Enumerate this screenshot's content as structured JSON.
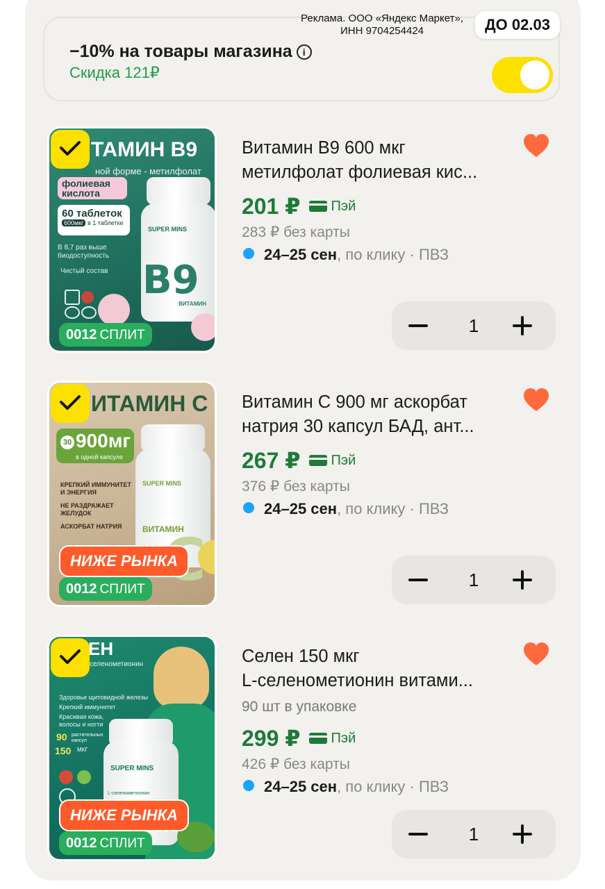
{
  "ad": {
    "line1": "Реклама. ООО «Яндекс Маркет»,",
    "line2": "ИНН 9704254424",
    "date_badge": "ДО 02.03"
  },
  "promo": {
    "title": "−10% на товары магазина",
    "info_icon": "i",
    "discount": "Скидка 121₽",
    "toggle_on": true,
    "toggle_color": "#fce000"
  },
  "items": [
    {
      "name_line1": "Витамин B9 600 мкг",
      "name_line2": "метилфолат фолиевая кис...",
      "pack": "",
      "price": "201 ₽",
      "pay": "Пэй",
      "old_price": "283 ₽  без карты",
      "delivery_date": "24–25 сен",
      "delivery_rest": ", по клику · ПВЗ",
      "qty": "1",
      "minus": "−",
      "plus": "+",
      "thumb": {
        "title": "ТАМИН B9",
        "subtitle": "ной форме - метилфолат",
        "tag": "фолиевая кислота",
        "tablets": "60 таблеток",
        "dose": "600мкг",
        "dose_note": "в 1 таблетке",
        "bio": "В 8,7 раз выше биодоступность",
        "clean": "Чистый состав",
        "brand": "SUPER MINS",
        "letter": "B9",
        "label_small": "ВИТАМИН",
        "split": "0012",
        "split_word": "СПЛИТ",
        "lower": ""
      }
    },
    {
      "name_line1": "Витамин C 900 мг аскорбат",
      "name_line2": "натрия 30 капсул БАД, ант...",
      "pack": "",
      "price": "267 ₽",
      "pay": "Пэй",
      "old_price": "376 ₽  без карты",
      "delivery_date": "24–25 сен",
      "delivery_rest": ", по клику · ПВЗ",
      "qty": "1",
      "minus": "−",
      "plus": "+",
      "thumb": {
        "title": "ИТАМИН С",
        "dose": "900мг",
        "count": "30",
        "dose_note": "в одной капсуле",
        "b1": "КРЕПКИЙ ИММУНИТЕТ И ЭНЕРГИЯ",
        "b2": "НЕ РАЗДРАЖАЕТ ЖЕЛУДОК",
        "b3": "АСКОРБАТ НАТРИЯ",
        "brand": "SUPER MINS",
        "label_small": "ВИТАМИН",
        "letter": "C",
        "split": "0012",
        "split_word": "СПЛИТ",
        "lower": "НИЖЕ РЫНКА"
      }
    },
    {
      "name_line1": "Селен 150 мкг",
      "name_line2": "L-селенометионин витами...",
      "pack": "90 шт в упаковке",
      "price": "299 ₽",
      "pay": "Пэй",
      "old_price": "426 ₽  без карты",
      "delivery_date": "24–25 сен",
      "delivery_rest": ", по клику · ПВЗ",
      "qty": "1",
      "minus": "−",
      "plus": "+",
      "thumb": {
        "title": "ЕН",
        "sub": "селенометионин",
        "b1": "Здоровье щитовидной железы",
        "b2": "Крепкий иммунитет",
        "b3": "Красивая кожа, волосы и ногти",
        "caps": "90",
        "caps_note": "растительных капсул",
        "mcg": "150",
        "mcg_note": "МКГ",
        "brand": "SUPER MINS",
        "label_small": "L-селенометионин",
        "split": "0012",
        "split_word": "СПЛИТ",
        "lower": "НИЖЕ РЫНКА"
      }
    }
  ],
  "colors": {
    "accent_yellow": "#fce000",
    "price_green": "#1f7a3a",
    "discount_green": "#1f9d48",
    "heart": "#ff6a3d",
    "delivery_dot": "#1aa3ff"
  }
}
